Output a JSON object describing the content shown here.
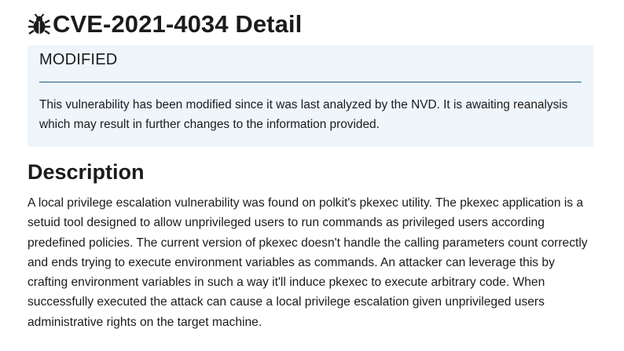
{
  "title": {
    "icon": "bug-icon",
    "text": "CVE-2021-4034 Detail"
  },
  "notice": {
    "heading": "MODIFIED",
    "text": "This vulnerability has been modified since it was last analyzed by the NVD. It is awaiting reanalysis which may result in further changes to the information provided.",
    "background_color": "#eef5fb",
    "rule_color": "#1f5d85"
  },
  "description": {
    "heading": "Description",
    "text": "A local privilege escalation vulnerability was found on polkit's pkexec utility. The pkexec application is a setuid tool designed to allow unprivileged users to run commands as privileged users according predefined policies. The current version of pkexec doesn't handle the calling parameters count correctly and ends trying to execute environment variables as commands. An attacker can leverage this by crafting environment variables in such a way it'll induce pkexec to execute arbitrary code. When successfully executed the attack can cause a local privilege escalation given unprivileged users administrative rights on the target machine."
  }
}
